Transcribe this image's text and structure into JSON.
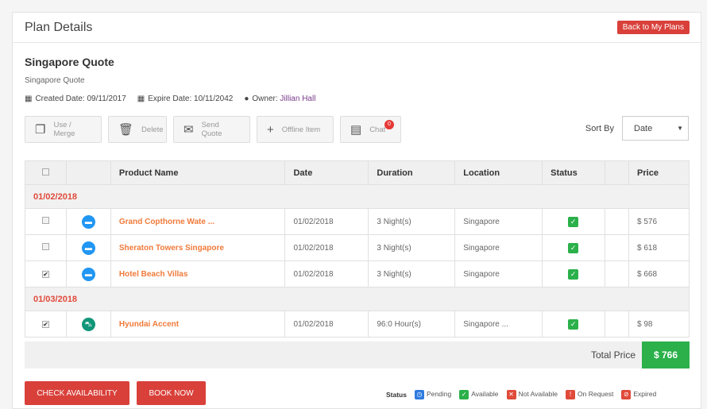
{
  "header": {
    "title": "Plan Details",
    "back_label": "Back to My Plans"
  },
  "plan": {
    "title": "Singapore Quote",
    "subtitle": "Singapore Quote",
    "created": "Created Date: 09/11/2017",
    "expire": "Expire Date: 10/11/2042",
    "owner_label": "Owner:",
    "owner": "Jillian Hall"
  },
  "toolbar": {
    "use_merge": "Use / Merge",
    "delete": "Delete",
    "send_quote": "Send Quote",
    "offline_item": "Offline Item",
    "chat": "Chat",
    "chat_count": "0"
  },
  "sort": {
    "label": "Sort By",
    "value": "Date"
  },
  "table": {
    "headers": [
      "Product Name",
      "Date",
      "Duration",
      "Location",
      "Status",
      "Price"
    ],
    "groups": [
      {
        "date": "01/02/2018",
        "rows": [
          {
            "name": "Grand Copthorne Wate ...",
            "date": "01/02/2018",
            "duration": "3 Night(s)",
            "location": "Singapore",
            "price": "$ 576",
            "checked": false,
            "type": "hotel"
          },
          {
            "name": "Sheraton Towers Singapore",
            "date": "01/02/2018",
            "duration": "3 Night(s)",
            "location": "Singapore",
            "price": "$ 618",
            "checked": false,
            "type": "hotel"
          },
          {
            "name": "Hotel Beach Villas",
            "date": "01/02/2018",
            "duration": "3 Night(s)",
            "location": "Singapore",
            "price": "$ 668",
            "checked": true,
            "type": "hotel"
          }
        ]
      },
      {
        "date": "01/03/2018",
        "rows": [
          {
            "name": "Hyundai Accent",
            "date": "01/02/2018",
            "duration": "96:0 Hour(s)",
            "location": "Singapore ...",
            "price": "$ 98",
            "checked": true,
            "type": "car"
          }
        ]
      }
    ]
  },
  "total": {
    "label": "Total Price",
    "value": "$ 766"
  },
  "actions": {
    "check": "CHECK AVAILABILITY",
    "book": "BOOK NOW"
  },
  "legend": {
    "title": "Status",
    "pending": "Pending",
    "available": "Available",
    "not_available": "Not Available",
    "on_request": "On Request",
    "expired": "Expired"
  },
  "colors": {
    "accent": "#d9403a",
    "product": "#f07a3a",
    "ok": "#2bb04a",
    "hotel": "#2196f3",
    "car": "#12967a"
  }
}
